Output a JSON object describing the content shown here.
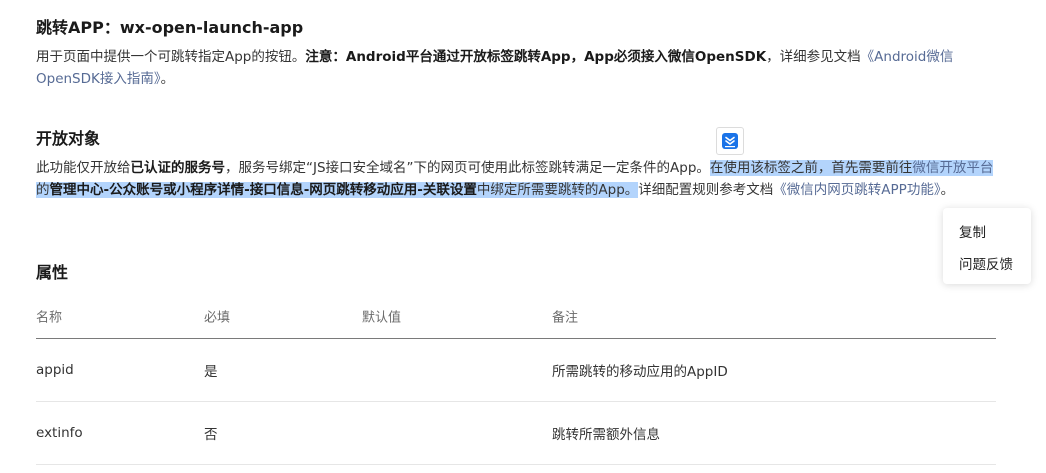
{
  "section_launch": {
    "title": "跳转APP：wx-open-launch-app",
    "p1": "用于页面中提供一个可跳转指定App的按钮。",
    "note_label": "注意：",
    "note_bold": "Android平台通过开放标签跳转App，App必须接入微信OpenSDK",
    "p2": "，详细参见文档",
    "doc_link": "《Android微信OpenSDK接入指南》",
    "p3": "。"
  },
  "section_open": {
    "title": "开放对象",
    "t1": "此功能仅开放给",
    "t1_bold": "已认证的服务号",
    "t2": "，服务号绑定“JS接口安全域名”下的网页可使用此标签跳转满足一定条件的App。",
    "hl1": "在使用该标签之前，首先需要前往",
    "hl_link": "微信开放平台",
    "hl2": "的",
    "hl_bold": "管理中心-公众账号或小程序详情-接口信息-网页跳转移动应用-关联设置",
    "hl3": "中绑定所需要跳转的App。",
    "t3": "详细配置规则参考文档",
    "doc_link": "《微信内网页跳转APP功能》",
    "t4": "。"
  },
  "section_props": {
    "title": "属性",
    "columns": [
      "名称",
      "必填",
      "默认值",
      "备注"
    ],
    "rows": [
      [
        "appid",
        "是",
        "",
        "所需跳转的移动应用的AppID"
      ],
      [
        "extinfo",
        "否",
        "",
        "跳转所需额外信息"
      ]
    ]
  },
  "context_menu": {
    "copy": "复制",
    "feedback": "问题反馈"
  },
  "colors": {
    "link": "#576b95",
    "selection": "#b3d4fc",
    "bubble_icon": "#1a73e8"
  },
  "icons": {
    "floating_bubble": "download-tray-icon"
  }
}
